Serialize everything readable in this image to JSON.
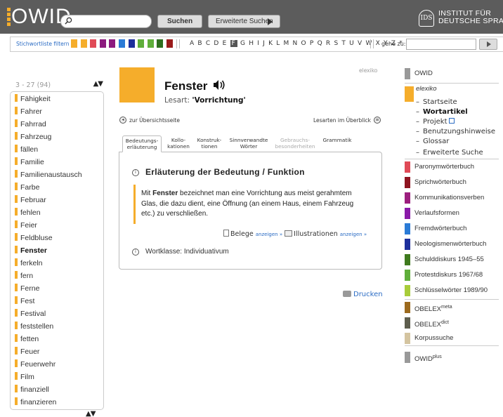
{
  "header": {
    "logo_text": "OWID",
    "search_placeholder": "",
    "search_button": "Suchen",
    "advanced_search_button": "Erweiterte Suchen",
    "institute_line1": "INSTITUT FÜR",
    "institute_line2": "DEUTSCHE SPRACHE",
    "institute_seal": "IDS"
  },
  "filterbar": {
    "label": "Stichwortliste filtern",
    "swatch_colors": [
      "#f5ad2b",
      "#f5ad2b",
      "#e04a57",
      "#8c1a7e",
      "#8c1a7e",
      "#2b7bd6",
      "#1d2f9c",
      "#5fae3a",
      "#5fae3a",
      "#2e6e1e",
      "#9a1b1b"
    ],
    "letters_before": "A B C D E",
    "active_letter": "F",
    "letters_after": "G H I J K L M N O P Q R S T U V W X Y Z *",
    "goto_label": "gehe zu:"
  },
  "wordlist": {
    "range": "3 - 27 (94)",
    "items": [
      {
        "label": "Fähigkeit",
        "active": false
      },
      {
        "label": "Fahrer",
        "active": false
      },
      {
        "label": "Fahrrad",
        "active": false
      },
      {
        "label": "Fahrzeug",
        "active": false
      },
      {
        "label": "fällen",
        "active": false
      },
      {
        "label": "Familie",
        "active": false
      },
      {
        "label": "Familienaustausch",
        "active": false
      },
      {
        "label": "Farbe",
        "active": false
      },
      {
        "label": "Februar",
        "active": false
      },
      {
        "label": "fehlen",
        "active": false
      },
      {
        "label": "Feier",
        "active": false
      },
      {
        "label": "Feldbluse",
        "active": false
      },
      {
        "label": "Fenster",
        "active": true
      },
      {
        "label": "ferkeln",
        "active": false
      },
      {
        "label": "fern",
        "active": false
      },
      {
        "label": "Ferne",
        "active": false
      },
      {
        "label": "Fest",
        "active": false
      },
      {
        "label": "Festival",
        "active": false
      },
      {
        "label": "feststellen",
        "active": false
      },
      {
        "label": "fetten",
        "active": false
      },
      {
        "label": "Feuer",
        "active": false
      },
      {
        "label": "Feuerwehr",
        "active": false
      },
      {
        "label": "Film",
        "active": false
      },
      {
        "label": "finanziell",
        "active": false
      },
      {
        "label": "finanzieren",
        "active": false
      }
    ]
  },
  "entry": {
    "source_tag": "elexiko",
    "headword": "Fenster",
    "lesart_label": "Lesart:",
    "lesart_value": "'Vorrichtung'",
    "back_link": "zur Übersichtsseite",
    "overview_link": "Lesarten im Überblick",
    "tabs": [
      {
        "line1": "Bedeutungs-",
        "line2": "erläuterung",
        "state": "active"
      },
      {
        "line1": "Kollo-",
        "line2": "kationen",
        "state": "normal"
      },
      {
        "line1": "Konstruk-",
        "line2": "tionen",
        "state": "normal"
      },
      {
        "line1": "Sinnverwandte",
        "line2": "Wörter",
        "state": "normal"
      },
      {
        "line1": "Gebrauchs-",
        "line2": "besonderheiten",
        "state": "disabled"
      },
      {
        "line1": "Grammatik",
        "line2": "",
        "state": "normal"
      }
    ],
    "section_title": "Erläuterung der Bedeutung / Funktion",
    "definition_prefix": "Mit",
    "definition_word": "Fenster",
    "definition_rest": "bezeichnet man eine Vorrichtung aus meist gerahmtem Glas, die dazu dient, eine Öffnung (an einem Haus, einem Fahrzeug etc.) zu verschließen.",
    "belege_label": "Belege",
    "belege_link": "anzeigen »",
    "illustrationen_label": "Illustrationen",
    "illustrationen_link": "anzeigen »",
    "wortklasse": "Wortklasse: Individuativum",
    "print_link": "Drucken"
  },
  "right_menu": {
    "top": {
      "label": "OWID",
      "color": "#999999"
    },
    "elexiko": {
      "label": "elexiko",
      "color": "#f5ad2b"
    },
    "elexiko_sub": [
      {
        "label": "Startseite",
        "bold": false
      },
      {
        "label": "Wortartikel",
        "bold": true
      },
      {
        "label": "Projekt",
        "bold": false,
        "external": true
      },
      {
        "label": "Benutzungshinweise",
        "bold": false
      },
      {
        "label": "Glossar",
        "bold": false
      },
      {
        "label": "Erweiterte Suche",
        "bold": false
      }
    ],
    "dictionaries": [
      {
        "label": "Paronymwörterbuch",
        "color": "#e04a57"
      },
      {
        "label": "Sprichwörterbuch",
        "color": "#8e1420"
      },
      {
        "label": "Kommunikationsverben",
        "color": "#9c1f7e"
      },
      {
        "label": "Verlaufsformen",
        "color": "#8a1aa8"
      },
      {
        "label": "Fremdwörterbuch",
        "color": "#2b7bd6"
      },
      {
        "label": "Neologismenwörterbuch",
        "color": "#1d2f9c"
      },
      {
        "label": "Schulddiskurs 1945–55",
        "color": "#3f7a1e"
      },
      {
        "label": "Protestdiskurs 1967/68",
        "color": "#5fae3a"
      },
      {
        "label": "Schlüsselwörter 1989/90",
        "color": "#a8cc3a"
      }
    ],
    "obelex_meta": {
      "label": "OBELEX",
      "sup": "meta",
      "color": "#9c6a1e"
    },
    "obelex_dict": {
      "label": "OBELEX",
      "sup": "dict",
      "color": "#5e5e4e"
    },
    "korpussuche": {
      "label": "Korpussuche",
      "color": "#d4c4a0"
    },
    "owid_plus": {
      "label": "OWID",
      "sup": "plus",
      "color": "#999999"
    }
  }
}
